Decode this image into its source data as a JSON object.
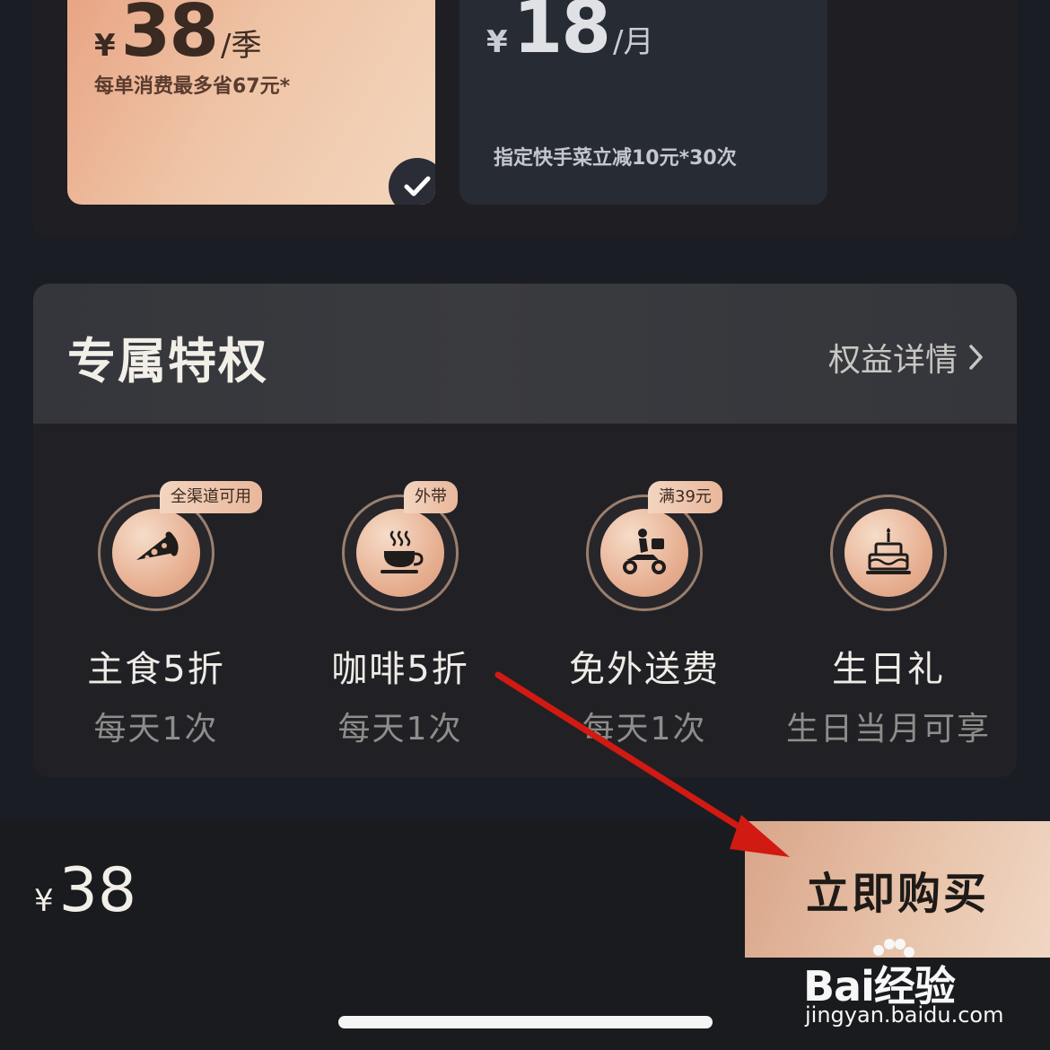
{
  "plans": {
    "selected": {
      "currency": "¥",
      "amount": "38",
      "unit": "/季",
      "note": "每单消费最多省67元*"
    },
    "other": {
      "currency": "¥",
      "amount": "18",
      "unit": "/月",
      "note": "指定快手菜立减10元*30次"
    }
  },
  "privileges": {
    "title": "专属特权",
    "details_link": "权益详情",
    "items": [
      {
        "name": "主食5折",
        "sub": "每天1次",
        "tag": "全渠道可用",
        "icon": "pizza-icon"
      },
      {
        "name": "咖啡5折",
        "sub": "每天1次",
        "tag": "外带",
        "icon": "coffee-cup-icon"
      },
      {
        "name": "免外送费",
        "sub": "每天1次",
        "tag": "满39元",
        "icon": "delivery-scooter-icon"
      },
      {
        "name": "生日礼",
        "sub": "生日当月可享",
        "tag": "",
        "icon": "birthday-cake-icon"
      }
    ]
  },
  "bottom": {
    "currency": "¥",
    "total": "38",
    "buy_label": "立即购买"
  },
  "watermark": {
    "logo": "Bai经验",
    "url": "jingyan.baidu.com"
  },
  "colors": {
    "accent": "#e8b597",
    "background": "#1b1d24",
    "annotation_arrow": "#d11a12"
  }
}
